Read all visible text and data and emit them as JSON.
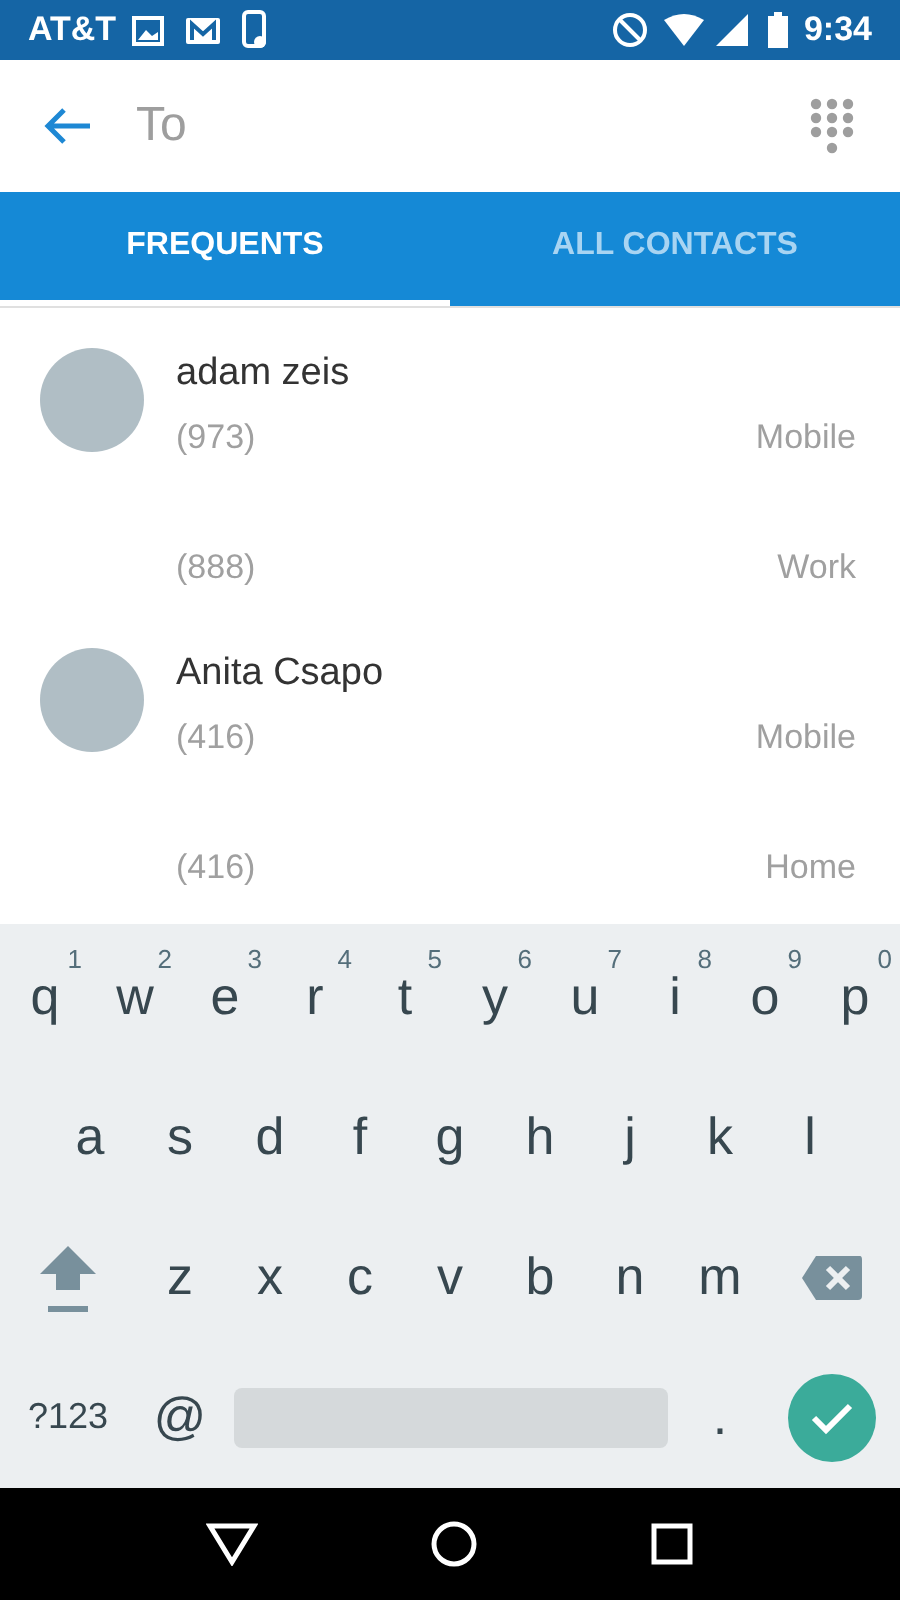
{
  "status_bar": {
    "carrier": "AT&T",
    "time": "9:34"
  },
  "search": {
    "placeholder": "To"
  },
  "tabs": [
    {
      "label": "FREQUENTS",
      "selected": true
    },
    {
      "label": "ALL CONTACTS",
      "selected": false
    }
  ],
  "contacts": [
    {
      "name": "adam zeis",
      "phones": [
        {
          "number": "(973)",
          "type": "Mobile"
        },
        {
          "number": "(888)",
          "type": "Work"
        }
      ]
    },
    {
      "name": "Anita Csapo",
      "phones": [
        {
          "number": "(416)",
          "type": "Mobile"
        },
        {
          "number": "(416)",
          "type": "Home"
        }
      ]
    }
  ],
  "keyboard": {
    "rows": [
      [
        {
          "kind": "letter",
          "label": "q",
          "hint": "1"
        },
        {
          "kind": "letter",
          "label": "w",
          "hint": "2"
        },
        {
          "kind": "letter",
          "label": "e",
          "hint": "3"
        },
        {
          "kind": "letter",
          "label": "r",
          "hint": "4"
        },
        {
          "kind": "letter",
          "label": "t",
          "hint": "5"
        },
        {
          "kind": "letter",
          "label": "y",
          "hint": "6"
        },
        {
          "kind": "letter",
          "label": "u",
          "hint": "7"
        },
        {
          "kind": "letter",
          "label": "i",
          "hint": "8"
        },
        {
          "kind": "letter",
          "label": "o",
          "hint": "9"
        },
        {
          "kind": "letter",
          "label": "p",
          "hint": "0"
        }
      ],
      [
        {
          "kind": "letter",
          "label": "a"
        },
        {
          "kind": "letter",
          "label": "s"
        },
        {
          "kind": "letter",
          "label": "d"
        },
        {
          "kind": "letter",
          "label": "f"
        },
        {
          "kind": "letter",
          "label": "g"
        },
        {
          "kind": "letter",
          "label": "h"
        },
        {
          "kind": "letter",
          "label": "j"
        },
        {
          "kind": "letter",
          "label": "k"
        },
        {
          "kind": "letter",
          "label": "l"
        }
      ],
      [
        {
          "kind": "shift"
        },
        {
          "kind": "letter",
          "label": "z"
        },
        {
          "kind": "letter",
          "label": "x"
        },
        {
          "kind": "letter",
          "label": "c"
        },
        {
          "kind": "letter",
          "label": "v"
        },
        {
          "kind": "letter",
          "label": "b"
        },
        {
          "kind": "letter",
          "label": "n"
        },
        {
          "kind": "letter",
          "label": "m"
        },
        {
          "kind": "backspace"
        }
      ]
    ],
    "bottom_row": {
      "symbols_key": "?123",
      "at_key": "@",
      "period_key": "."
    }
  }
}
